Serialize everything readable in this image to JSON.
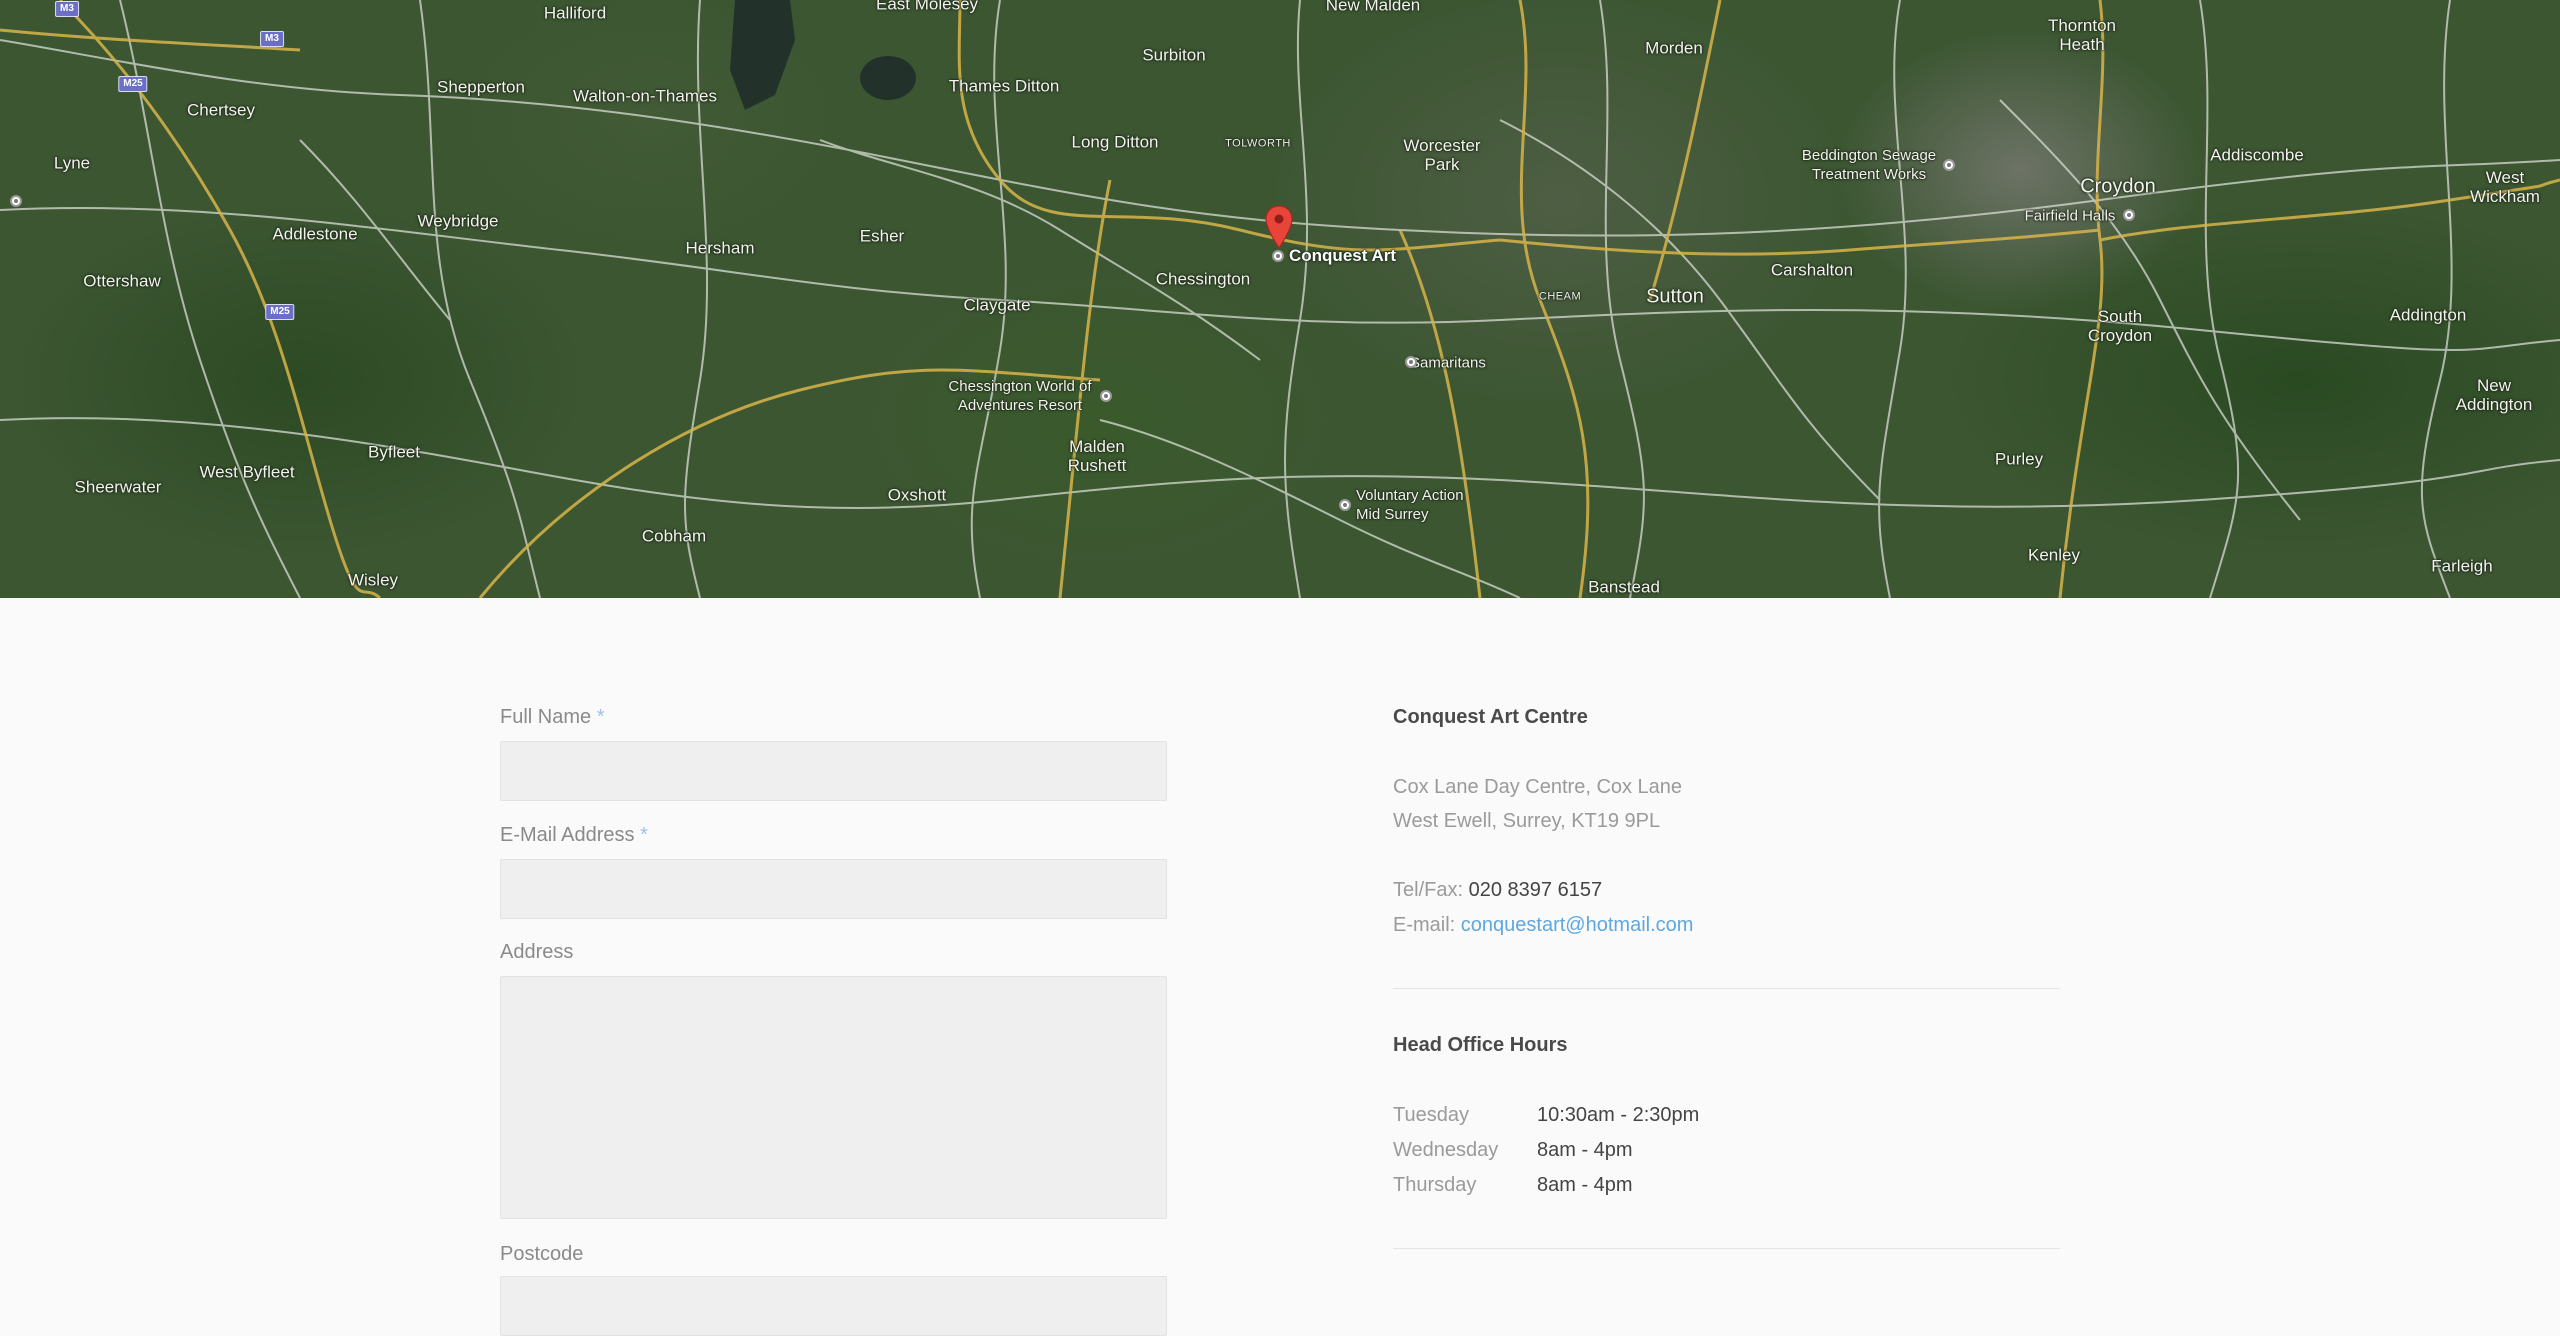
{
  "map": {
    "marker_label": "Conquest Art",
    "towns": [
      {
        "name": "East Molesey"
      },
      {
        "name": "New Malden"
      },
      {
        "name": "Halliford"
      },
      {
        "name": "Surbiton"
      },
      {
        "name": "Morden"
      },
      {
        "name": "Thornton Heath"
      },
      {
        "name": "Shepperton"
      },
      {
        "name": "Walton-on-Thames"
      },
      {
        "name": "Thames Ditton"
      },
      {
        "name": "Chertsey"
      },
      {
        "name": "Long Ditton"
      },
      {
        "name": "Worcester Park"
      },
      {
        "name": "Beddington Sewage Treatment Works"
      },
      {
        "name": "Addiscombe"
      },
      {
        "name": "Croydon"
      },
      {
        "name": "West Wickham"
      },
      {
        "name": "Lyne"
      },
      {
        "name": "Weybridge"
      },
      {
        "name": "Addlestone"
      },
      {
        "name": "Hersham"
      },
      {
        "name": "Esher"
      },
      {
        "name": "Chessington"
      },
      {
        "name": "Fairfield Halls"
      },
      {
        "name": "Carshalton"
      },
      {
        "name": "Sutton"
      },
      {
        "name": "Ottershaw"
      },
      {
        "name": "Claygate"
      },
      {
        "name": "South Croydon"
      },
      {
        "name": "Addington"
      },
      {
        "name": "Samaritans"
      },
      {
        "name": "Chessington World of Adventures Resort"
      },
      {
        "name": "New Addington"
      },
      {
        "name": "Byfleet"
      },
      {
        "name": "Malden Rushett"
      },
      {
        "name": "Purley"
      },
      {
        "name": "Sheerwater"
      },
      {
        "name": "West Byfleet"
      },
      {
        "name": "Oxshott"
      },
      {
        "name": "Voluntary Action Mid Surrey"
      },
      {
        "name": "Cobham"
      },
      {
        "name": "Kenley"
      },
      {
        "name": "Farleigh"
      },
      {
        "name": "Wisley"
      },
      {
        "name": "Banstead"
      }
    ],
    "small_labels": [
      "TOLWORTH",
      "CHEAM"
    ],
    "road_shields": [
      "M3",
      "M3",
      "M25",
      "M25"
    ]
  },
  "form": {
    "full_name": {
      "label": "Full Name",
      "required_mark": "*",
      "value": ""
    },
    "email": {
      "label": "E-Mail Address",
      "required_mark": "*",
      "value": ""
    },
    "address": {
      "label": "Address",
      "value": ""
    },
    "postcode": {
      "label": "Postcode",
      "value": ""
    }
  },
  "contact": {
    "org_name": "Conquest Art Centre",
    "address_line1": "Cox Lane Day Centre, Cox Lane",
    "address_line2": "West Ewell, Surrey, KT19 9PL",
    "tel_label": "Tel/Fax:",
    "tel_value": "020 8397 6157",
    "email_label": "E-mail:",
    "email_value": "conquestart@hotmail.com"
  },
  "hours": {
    "title": "Head Office Hours",
    "rows": [
      {
        "day": "Tuesday",
        "time": "10:30am - 2:30pm"
      },
      {
        "day": "Wednesday",
        "time": "8am - 4pm"
      },
      {
        "day": "Thursday",
        "time": "8am - 4pm"
      }
    ]
  },
  "colors": {
    "accent_link": "#5ea7e0",
    "required_mark": "#9ec2e6",
    "marker": "#e8443a",
    "page_background": "#fafafa"
  }
}
